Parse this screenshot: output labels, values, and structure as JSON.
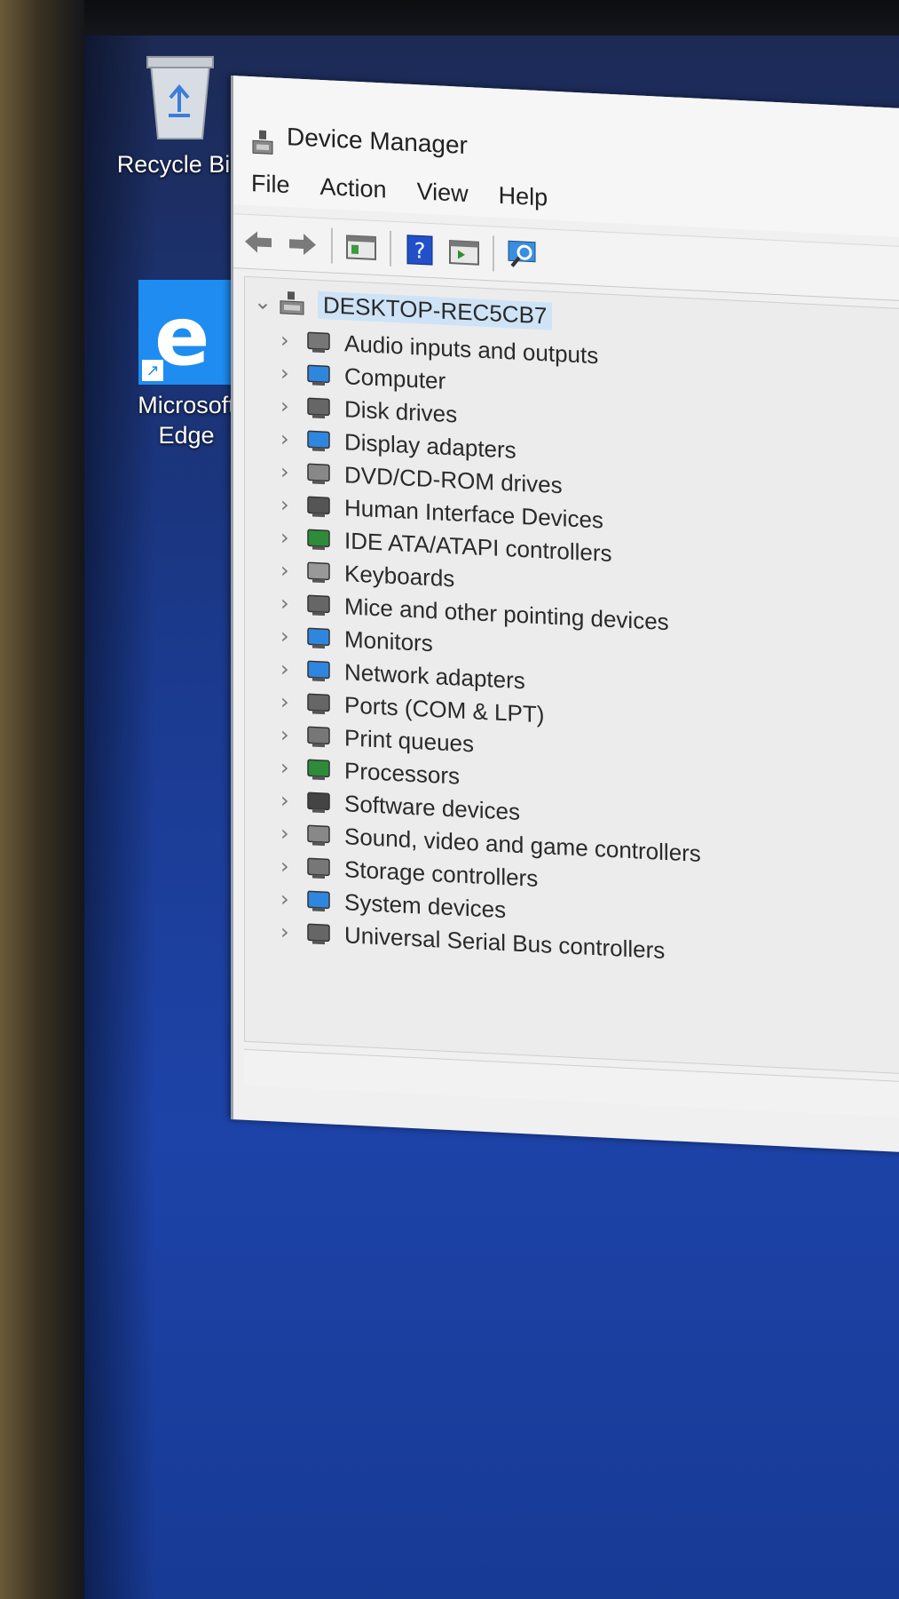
{
  "desktop": {
    "icons": [
      {
        "label": "Recycle Bin"
      },
      {
        "label": "Microsoft\nEdge",
        "line1": "Microsoft",
        "line2": "Edge"
      }
    ]
  },
  "window": {
    "title": "Device Manager",
    "menu": [
      "File",
      "Action",
      "View",
      "Help"
    ],
    "toolbar": [
      "back-icon",
      "forward-icon",
      "properties-icon",
      "help-icon",
      "update-driver-icon",
      "scan-hardware-icon"
    ]
  },
  "tree": {
    "root": "DESKTOP-REC5CB7",
    "categories": [
      {
        "label": "Audio inputs and outputs",
        "icon": "speaker-icon"
      },
      {
        "label": "Computer",
        "icon": "computer-icon"
      },
      {
        "label": "Disk drives",
        "icon": "disk-drive-icon"
      },
      {
        "label": "Display adapters",
        "icon": "display-adapter-icon"
      },
      {
        "label": "DVD/CD-ROM drives",
        "icon": "dvd-drive-icon"
      },
      {
        "label": "Human Interface Devices",
        "icon": "hid-icon"
      },
      {
        "label": "IDE ATA/ATAPI controllers",
        "icon": "ide-controller-icon"
      },
      {
        "label": "Keyboards",
        "icon": "keyboard-icon"
      },
      {
        "label": "Mice and other pointing devices",
        "icon": "mouse-icon"
      },
      {
        "label": "Monitors",
        "icon": "monitor-icon"
      },
      {
        "label": "Network adapters",
        "icon": "network-adapter-icon"
      },
      {
        "label": "Ports (COM & LPT)",
        "icon": "port-icon"
      },
      {
        "label": "Print queues",
        "icon": "printer-icon"
      },
      {
        "label": "Processors",
        "icon": "processor-icon"
      },
      {
        "label": "Software devices",
        "icon": "software-device-icon"
      },
      {
        "label": "Sound, video and game controllers",
        "icon": "sound-controller-icon"
      },
      {
        "label": "Storage controllers",
        "icon": "storage-controller-icon"
      },
      {
        "label": "System devices",
        "icon": "system-device-icon"
      },
      {
        "label": "Universal Serial Bus controllers",
        "icon": "usb-icon"
      }
    ]
  },
  "colors": {
    "desktop": "#1d43a8",
    "selection": "#cfe3f7",
    "edge_tile": "#1e8cf0"
  }
}
